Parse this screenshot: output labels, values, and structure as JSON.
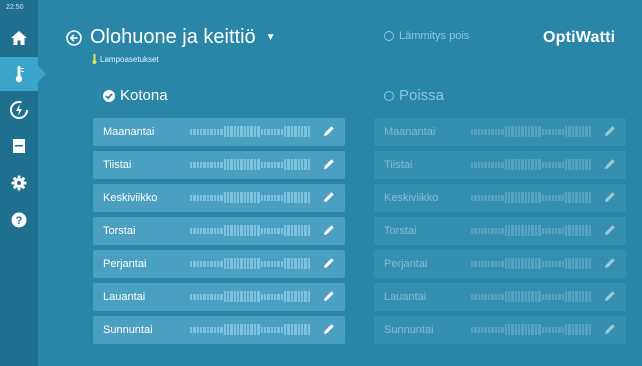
{
  "status_bar": {
    "clock": "22:50"
  },
  "sidebar": {
    "items": [
      {
        "icon": "home-icon"
      },
      {
        "icon": "thermometer-icon",
        "active": true
      },
      {
        "icon": "power-icon"
      },
      {
        "icon": "device-icon"
      },
      {
        "icon": "gear-icon"
      },
      {
        "icon": "help-icon"
      }
    ]
  },
  "header": {
    "room_title": "Olohuone ja keittiö",
    "subtitle": "Lampoasetukset",
    "heating_status": "Lämmitys pois",
    "logo": "OptiWatti"
  },
  "columns": {
    "home": {
      "title": "Kotona",
      "selected": true,
      "days": [
        "Maanantai",
        "Tiistai",
        "Keskiviikko",
        "Torstai",
        "Perjantai",
        "Lauantai",
        "Sunnuntai"
      ]
    },
    "away": {
      "title": "Poissa",
      "selected": false,
      "days": [
        "Maanantai",
        "Tiistai",
        "Keskiviikko",
        "Torstai",
        "Perjantai",
        "Lauantai",
        "Sunnuntai"
      ]
    }
  },
  "colors": {
    "background": "#2a86a9",
    "sidebar": "#1f6f8f",
    "active_nav": "#3aa4cb",
    "row_home": "#4b9fc0",
    "bar": "#7ec3dd"
  }
}
